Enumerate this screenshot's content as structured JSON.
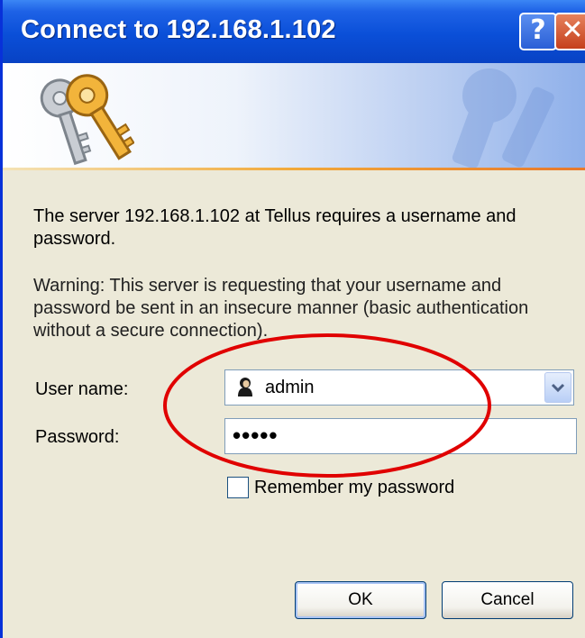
{
  "window": {
    "title": "Connect to 192.168.1.102",
    "help_glyph": "?",
    "close_glyph": "✕"
  },
  "message": {
    "line1": "The server 192.168.1.102 at Tellus requires a username and password.",
    "warning": "Warning: This server is requesting that your username and password be sent in an insecure manner (basic authentication without a secure connection)."
  },
  "form": {
    "username_label": "User name:",
    "username_value": "admin",
    "password_label": "Password:",
    "password_value": "•••••",
    "remember_label": "Remember my password",
    "remember_checked": false
  },
  "buttons": {
    "ok": "OK",
    "cancel": "Cancel"
  },
  "icons": {
    "banner": "keys-icon",
    "user": "user-icon",
    "dropdown": "chevron-down-icon"
  },
  "colors": {
    "titlebar": "#0a4fd8",
    "annotation": "#e00000",
    "dialog_bg": "#ece9d8"
  }
}
